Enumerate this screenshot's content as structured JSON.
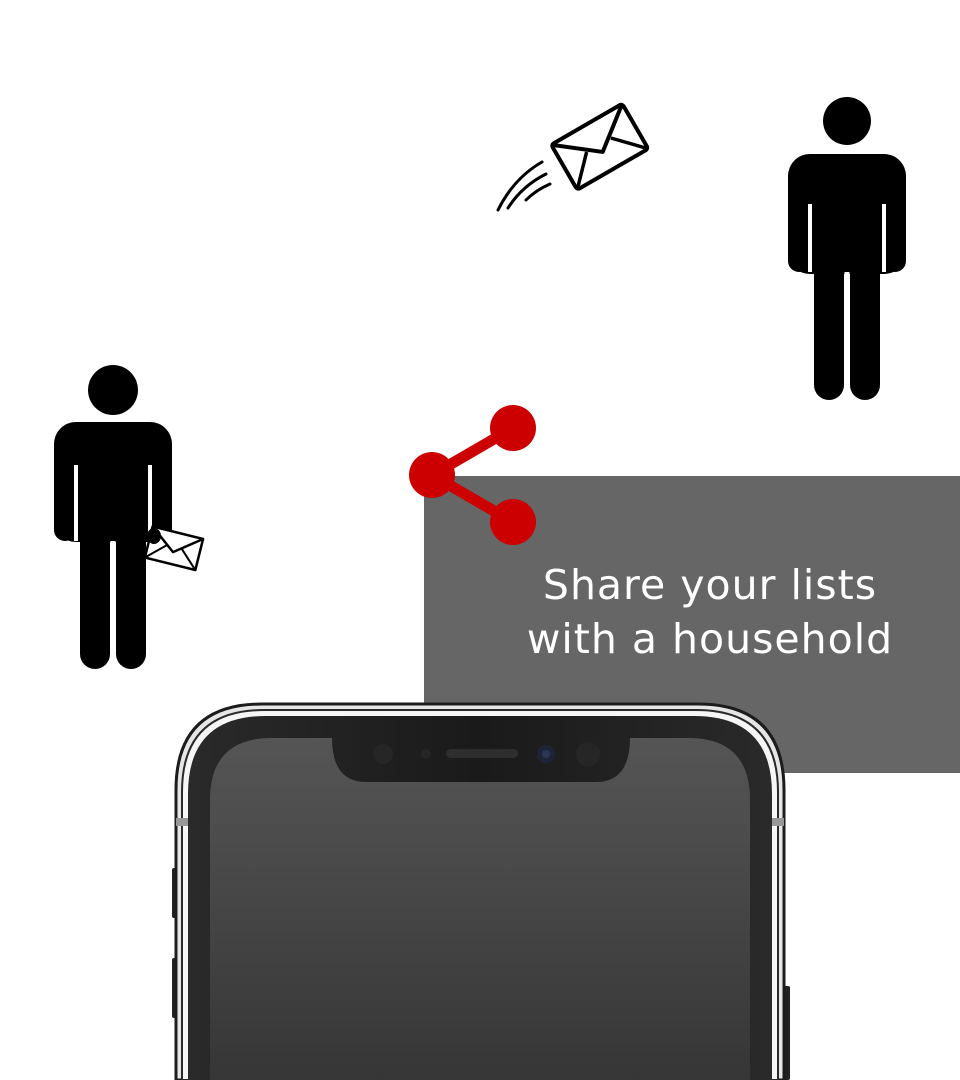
{
  "caption": {
    "line1": "Share your lists",
    "line2": "with a household"
  },
  "colors": {
    "background": "#ffffff",
    "banner": "#666666",
    "accent": "#cc0000",
    "figure": "#000000",
    "phone_screen": "#3c3c3c"
  },
  "icons": {
    "share": "share-icon",
    "person_sender": "person-icon",
    "person_recipient": "person-icon",
    "flying_envelope": "envelope-icon",
    "held_envelope": "envelope-icon",
    "phone": "smartphone"
  }
}
